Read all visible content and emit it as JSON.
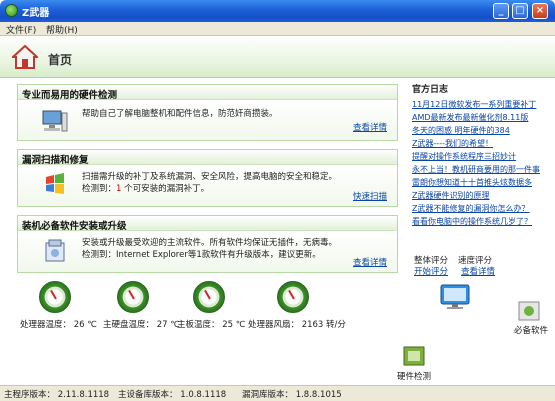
{
  "window": {
    "title": "Z武器"
  },
  "menu": {
    "file": "文件(F)",
    "help": "帮助(H)"
  },
  "header": {
    "title": "首页"
  },
  "panels": [
    {
      "title": "专业而易用的硬件检测",
      "desc1": "帮助自己了解电脑整机和配件信息，防范奸商攒装。",
      "link": "查看详情"
    },
    {
      "title": "漏洞扫描和修复",
      "desc1": "扫描需升级的补丁及系统漏洞、安全风险，提高电脑的安全和稳定。",
      "desc2_prefix": "检测到：",
      "desc2_count": "1",
      "desc2_suffix": " 个可安装的漏洞补丁。",
      "link": "快速扫描"
    },
    {
      "title": "装机必备软件安装或升级",
      "desc1": "安装或升级最受欢迎的主流软件。所有软件均保证无插件，无病毒。",
      "desc2": "检测到：Internet Explorer等1款软件有升级版本，建议更新。",
      "link": "查看详情"
    }
  ],
  "news": {
    "title": "官方日志",
    "items": [
      "11月12日微软发布一系列重要补丁",
      "AMD最新发布最新催化剂8.11版",
      "冬天的困惑 明年硬件的384",
      "Z武器----我们的希望！",
      "提醒对操作系统程序三招妙计",
      "永不上当！教机研商要用的那一件事",
      "雷朗你想知道十十首推头炫数据多",
      "Z武器硬件识别的原理",
      "Z武器不能修复的漏洞你怎么办？",
      "看看你电脑中的操作系统几岁了？"
    ]
  },
  "scores": {
    "overall_label": "整体评分",
    "overall_link": "开始评分",
    "speed_label": "速度评分",
    "speed_link": "查看详情"
  },
  "gauges": {
    "cpu": "处理器温度： 26 ℃",
    "chipset": "主硬盘温度： 27 ℃",
    "board": "主板温度： 25 ℃",
    "fan": "处理器风扇： 2163 转/分"
  },
  "shortcuts": {
    "monitor": "硬件检测",
    "software": "必备软件"
  },
  "status": {
    "main": "主程序版本： 2.11.8.1118",
    "device": "主设备库版本： 1.0.8.1118",
    "vuln": "漏洞库版本： 1.8.8.1015"
  },
  "colors": {
    "titlebar": "#1c5fd6",
    "accent_green": "#3f8f2a",
    "link": "#0a45a8",
    "alert": "#d40000"
  }
}
